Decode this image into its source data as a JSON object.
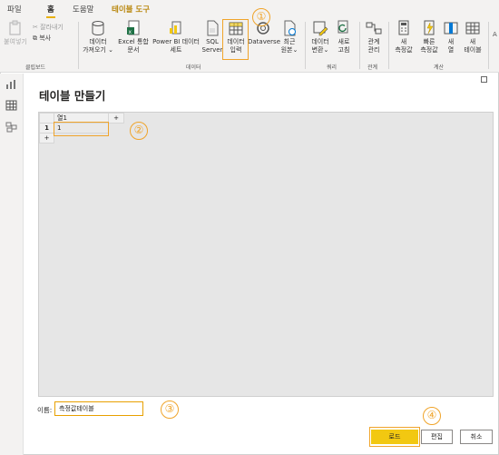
{
  "tabs": [
    {
      "label": "파일"
    },
    {
      "label": "홈"
    },
    {
      "label": "도움말"
    },
    {
      "label": "테이블 도구"
    }
  ],
  "ribbon": {
    "clipboard": {
      "paste": "붙여넣기",
      "cut": "잘라내기",
      "copy": "복사",
      "group": "클립보드"
    },
    "data": {
      "get_data": [
        "데이터",
        "가져오기"
      ],
      "excel": [
        "Excel 통합",
        "문서"
      ],
      "powerbi": [
        "Power BI 데이터",
        "세트"
      ],
      "sql": [
        "SQL",
        "Server"
      ],
      "enter_data": [
        "데이터",
        "입력"
      ],
      "dataverse": "Dataverse",
      "recent": [
        "최근",
        "원본"
      ],
      "group": "데이터"
    },
    "query": {
      "transform": [
        "데이터",
        "변환"
      ],
      "refresh": [
        "새로",
        "고침"
      ],
      "group": "쿼리"
    },
    "relations": {
      "manage": [
        "관계",
        "관리"
      ],
      "group": "관계"
    },
    "calc": {
      "new_measure": [
        "새",
        "측정값"
      ],
      "quick_measure": [
        "빠른",
        "측정값"
      ],
      "new_column": [
        "새",
        "열"
      ],
      "new_table": [
        "새",
        "테이블"
      ],
      "group": "계산"
    },
    "overflow": "A"
  },
  "dialog": {
    "title": "테이블 만들기",
    "table": {
      "column_header": "열1",
      "add_column": "+",
      "rows": [
        {
          "num": "1",
          "value": "1"
        }
      ],
      "add_row": "+"
    },
    "name_label": "이름:",
    "name_value": "측정값테이블",
    "buttons": {
      "load": "로드",
      "edit": "편집",
      "cancel": "취소"
    }
  },
  "callouts": [
    "①",
    "②",
    "③",
    "④"
  ],
  "colors": {
    "accent": "#f2c811",
    "callout": "#f0a42a",
    "tool_tab": "#b8860b"
  }
}
